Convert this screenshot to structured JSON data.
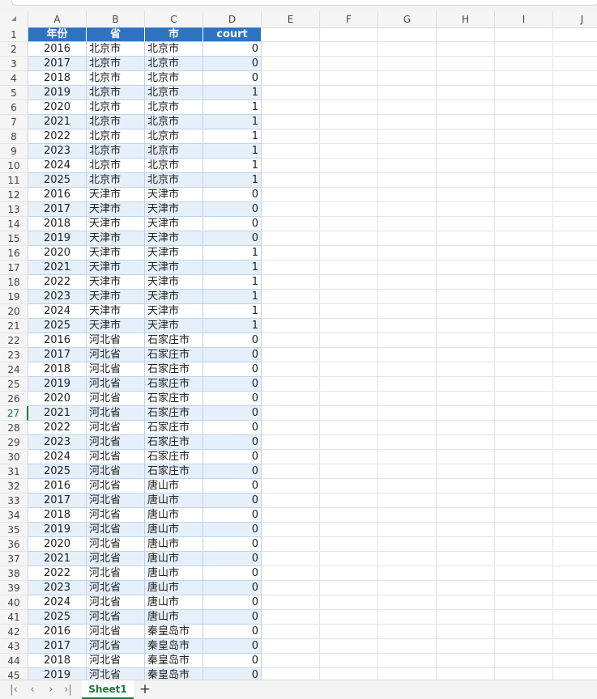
{
  "columns": [
    "A",
    "B",
    "C",
    "D",
    "E",
    "F",
    "G",
    "H",
    "I",
    "J"
  ],
  "header_row": {
    "A": "年份",
    "B": "省",
    "C": "市",
    "D": "court"
  },
  "rows": [
    [
      "2016",
      "北京市",
      "北京市",
      "0"
    ],
    [
      "2017",
      "北京市",
      "北京市",
      "0"
    ],
    [
      "2018",
      "北京市",
      "北京市",
      "0"
    ],
    [
      "2019",
      "北京市",
      "北京市",
      "1"
    ],
    [
      "2020",
      "北京市",
      "北京市",
      "1"
    ],
    [
      "2021",
      "北京市",
      "北京市",
      "1"
    ],
    [
      "2022",
      "北京市",
      "北京市",
      "1"
    ],
    [
      "2023",
      "北京市",
      "北京市",
      "1"
    ],
    [
      "2024",
      "北京市",
      "北京市",
      "1"
    ],
    [
      "2025",
      "北京市",
      "北京市",
      "1"
    ],
    [
      "2016",
      "天津市",
      "天津市",
      "0"
    ],
    [
      "2017",
      "天津市",
      "天津市",
      "0"
    ],
    [
      "2018",
      "天津市",
      "天津市",
      "0"
    ],
    [
      "2019",
      "天津市",
      "天津市",
      "0"
    ],
    [
      "2020",
      "天津市",
      "天津市",
      "1"
    ],
    [
      "2021",
      "天津市",
      "天津市",
      "1"
    ],
    [
      "2022",
      "天津市",
      "天津市",
      "1"
    ],
    [
      "2023",
      "天津市",
      "天津市",
      "1"
    ],
    [
      "2024",
      "天津市",
      "天津市",
      "1"
    ],
    [
      "2025",
      "天津市",
      "天津市",
      "1"
    ],
    [
      "2016",
      "河北省",
      "石家庄市",
      "0"
    ],
    [
      "2017",
      "河北省",
      "石家庄市",
      "0"
    ],
    [
      "2018",
      "河北省",
      "石家庄市",
      "0"
    ],
    [
      "2019",
      "河北省",
      "石家庄市",
      "0"
    ],
    [
      "2020",
      "河北省",
      "石家庄市",
      "0"
    ],
    [
      "2021",
      "河北省",
      "石家庄市",
      "0"
    ],
    [
      "2022",
      "河北省",
      "石家庄市",
      "0"
    ],
    [
      "2023",
      "河北省",
      "石家庄市",
      "0"
    ],
    [
      "2024",
      "河北省",
      "石家庄市",
      "0"
    ],
    [
      "2025",
      "河北省",
      "石家庄市",
      "0"
    ],
    [
      "2016",
      "河北省",
      "唐山市",
      "0"
    ],
    [
      "2017",
      "河北省",
      "唐山市",
      "0"
    ],
    [
      "2018",
      "河北省",
      "唐山市",
      "0"
    ],
    [
      "2019",
      "河北省",
      "唐山市",
      "0"
    ],
    [
      "2020",
      "河北省",
      "唐山市",
      "0"
    ],
    [
      "2021",
      "河北省",
      "唐山市",
      "0"
    ],
    [
      "2022",
      "河北省",
      "唐山市",
      "0"
    ],
    [
      "2023",
      "河北省",
      "唐山市",
      "0"
    ],
    [
      "2024",
      "河北省",
      "唐山市",
      "0"
    ],
    [
      "2025",
      "河北省",
      "唐山市",
      "0"
    ],
    [
      "2016",
      "河北省",
      "秦皇岛市",
      "0"
    ],
    [
      "2017",
      "河北省",
      "秦皇岛市",
      "0"
    ],
    [
      "2018",
      "河北省",
      "秦皇岛市",
      "0"
    ],
    [
      "2019",
      "河北省",
      "秦皇岛市",
      "0"
    ]
  ],
  "active_row": 27,
  "sheet_tab": "Sheet1",
  "nav": {
    "first": "|‹",
    "prev": "‹",
    "next": "›",
    "last": "›|",
    "add": "+"
  },
  "colors": {
    "header_fill": "#2e73c1",
    "band_fill": "#e6f0fb",
    "accent": "#1a7a3e"
  }
}
